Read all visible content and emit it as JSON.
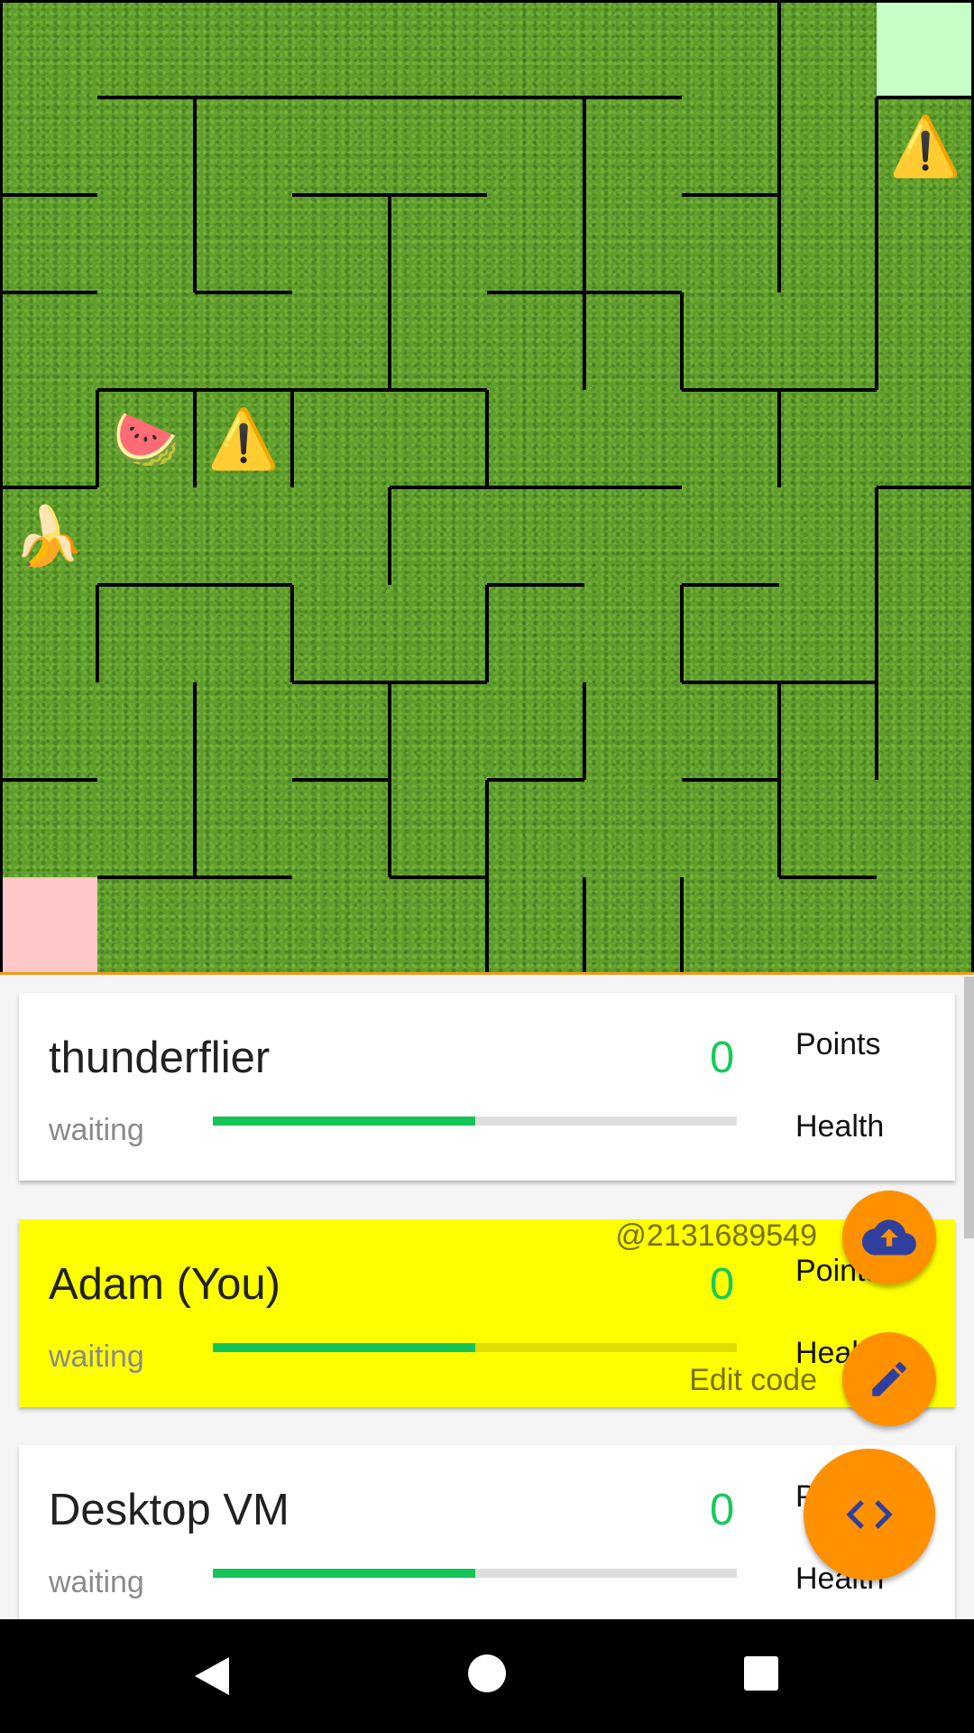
{
  "maze": {
    "grid_size": 10,
    "start_cell_color": "#ffc8c8",
    "goal_cell_color": "#c6ffc6",
    "goal_cell": [
      9,
      0
    ],
    "start_cell": [
      0,
      9
    ],
    "walls_horizontal": [
      [
        1,
        1,
        7
      ],
      [
        1,
        9,
        10
      ],
      [
        2,
        0,
        1
      ],
      [
        2,
        3,
        5
      ],
      [
        2,
        7,
        8
      ],
      [
        3,
        0,
        1
      ],
      [
        3,
        2,
        3
      ],
      [
        3,
        5,
        7
      ],
      [
        4,
        1,
        5
      ],
      [
        4,
        7,
        9
      ],
      [
        5,
        0,
        1
      ],
      [
        5,
        4,
        7
      ],
      [
        5,
        9,
        10
      ],
      [
        6,
        1,
        3
      ],
      [
        6,
        5,
        6
      ],
      [
        6,
        7,
        8
      ],
      [
        7,
        3,
        5
      ],
      [
        7,
        7,
        9
      ],
      [
        8,
        0,
        1
      ],
      [
        8,
        3,
        4
      ],
      [
        8,
        5,
        6
      ],
      [
        8,
        7,
        8
      ],
      [
        9,
        1,
        3
      ],
      [
        9,
        4,
        5
      ],
      [
        9,
        8,
        9
      ]
    ],
    "walls_vertical": [
      [
        2,
        1,
        3
      ],
      [
        8,
        0,
        3
      ],
      [
        6,
        1,
        4
      ],
      [
        4,
        2,
        4
      ],
      [
        9,
        1,
        4
      ],
      [
        7,
        3,
        4
      ],
      [
        1,
        4,
        5
      ],
      [
        2,
        4,
        5
      ],
      [
        3,
        4,
        5
      ],
      [
        5,
        4,
        5
      ],
      [
        8,
        4,
        5
      ],
      [
        4,
        5,
        6
      ],
      [
        9,
        5,
        8
      ],
      [
        1,
        6,
        7
      ],
      [
        3,
        6,
        7
      ],
      [
        5,
        6,
        7
      ],
      [
        7,
        6,
        7
      ],
      [
        2,
        7,
        9
      ],
      [
        4,
        7,
        9
      ],
      [
        6,
        7,
        8
      ],
      [
        8,
        7,
        9
      ],
      [
        5,
        8,
        10
      ],
      [
        6,
        9,
        10
      ],
      [
        7,
        9,
        10
      ]
    ],
    "items": [
      {
        "type": "warning-icon",
        "glyph": "⚠️",
        "cell": [
          9,
          1
        ]
      },
      {
        "type": "watermelon-icon",
        "glyph": "🍉",
        "cell": [
          1,
          4
        ]
      },
      {
        "type": "warning-icon",
        "glyph": "⚠️",
        "cell": [
          2,
          4
        ]
      },
      {
        "type": "banana-icon",
        "glyph": "🍌",
        "cell": [
          0,
          5
        ]
      }
    ]
  },
  "players": [
    {
      "name": "thunderflier",
      "points": "0",
      "points_label": "Points",
      "status": "waiting",
      "health_label": "Health",
      "health": 0.5,
      "is_you": false
    },
    {
      "name": "Adam (You)",
      "points": "0",
      "points_label": "Points",
      "status": "waiting",
      "health_label": "Health",
      "health": 0.5,
      "is_you": true
    },
    {
      "name": "Desktop VM",
      "points": "0",
      "points_label": "Points",
      "status": "waiting",
      "health_label": "Health",
      "health": 0.5,
      "is_you": false
    }
  ],
  "fab_menu": {
    "upload_label": "@2131689549",
    "edit_label": "Edit code",
    "accent": "#ff9000",
    "icon_color": "#2f3f9e"
  },
  "highlight_color": "#ffff00",
  "health_color": "#14c458"
}
